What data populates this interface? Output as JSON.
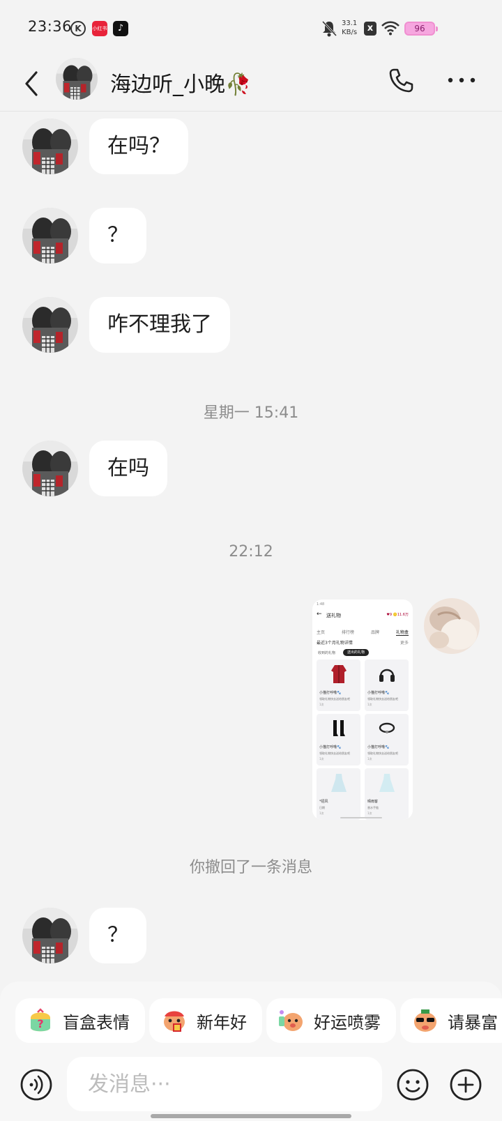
{
  "status_bar": {
    "time": "23:36",
    "k_icon": "K",
    "app1": "小红书",
    "app2": "♪",
    "net_speed_value": "33.1",
    "net_speed_unit": "KB/s",
    "battery": "96",
    "battery_color": "#f6a6df"
  },
  "header": {
    "title": "海边听_小晚🥀",
    "back_icon": "chevron-left-icon",
    "phone_icon": "phone-icon",
    "more_icon": "more-dots-icon"
  },
  "messages": [
    {
      "side": "left",
      "text": "在吗？"
    },
    {
      "side": "left",
      "text": "？"
    },
    {
      "side": "left",
      "text": "咋不理我了"
    },
    {
      "side": "left",
      "text": "在吗"
    },
    {
      "side": "left",
      "text": "？"
    }
  ],
  "timestamps": [
    "星期一 15:41",
    "22:12"
  ],
  "recall_notice": "你撤回了一条消息",
  "image_message": {
    "status": "1:48",
    "title": "送礼物",
    "pill": "♥9 🪙11.6万",
    "tabs": [
      "主页",
      "排行榜",
      "品牌",
      "礼物盒"
    ],
    "active_tab": "礼物盒",
    "subtitle": "最近3个月礼物详情",
    "more": "更多",
    "chips": [
      "收到的礼物",
      "送出的礼物"
    ],
    "cards": [
      {
        "name": "小猫打呼噜🐾",
        "desc": "领取礼物快去送给朋友吧",
        "count": "1次"
      },
      {
        "name": "小猫打呼噜🐾",
        "desc": "领取礼物快去送给朋友吧",
        "count": "1次"
      },
      {
        "name": "小猫打呼噜🐾",
        "desc": "领取礼物快去送给朋友吧",
        "count": "1次"
      },
      {
        "name": "小猫打呼噜🐾",
        "desc": "领取礼物快去送给朋友吧",
        "count": "1次"
      },
      {
        "name": "*招风",
        "desc": "日期",
        "count": "1次"
      },
      {
        "name": "晴雨客",
        "desc": "香水手链",
        "count": "1次"
      }
    ]
  },
  "quick_chips": [
    {
      "label": "盲盒表情",
      "icon": "mystery-box-icon"
    },
    {
      "label": "新年好",
      "icon": "lion-dance-icon"
    },
    {
      "label": "好运喷雾",
      "icon": "lucky-spray-icon"
    },
    {
      "label": "请暴富",
      "icon": "sunglasses-pig-icon"
    }
  ],
  "input": {
    "placeholder": "发消息···",
    "voice_icon": "voice-icon",
    "emoji_icon": "emoji-icon",
    "plus_icon": "plus-icon"
  }
}
